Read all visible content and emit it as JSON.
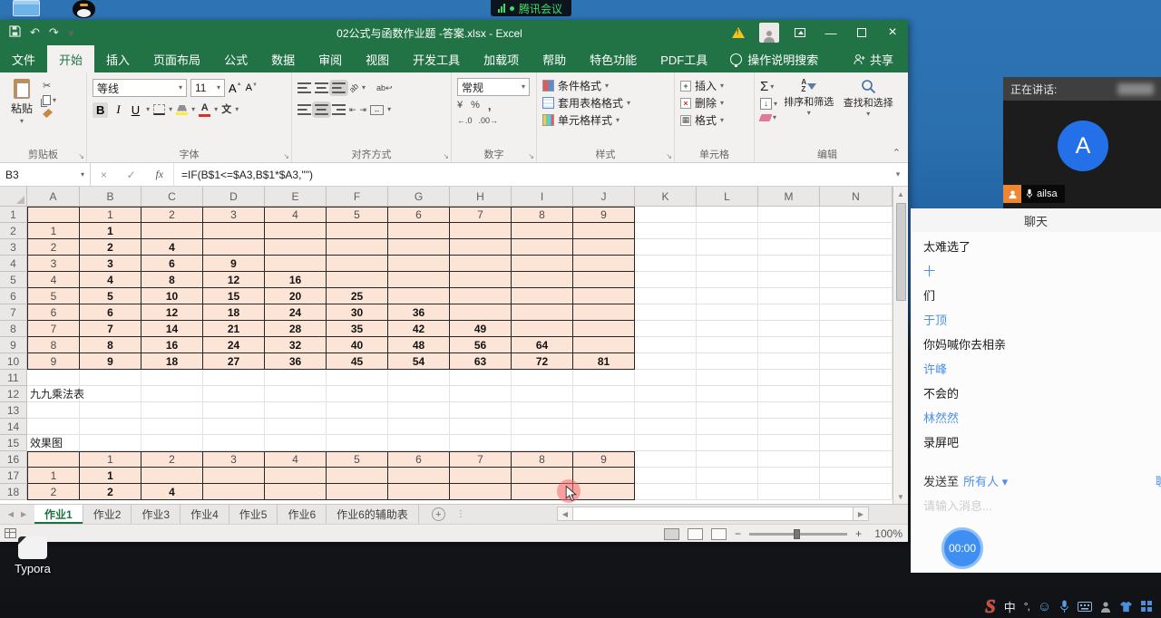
{
  "desktop": {
    "meeting_pill_label": "腾讯会议",
    "typora_label": "Typora"
  },
  "excel": {
    "title": "02公式与函数作业题 -答案.xlsx  -  Excel",
    "ribbon": {
      "tabs": [
        "文件",
        "开始",
        "插入",
        "页面布局",
        "公式",
        "数据",
        "审阅",
        "视图",
        "开发工具",
        "加载项",
        "帮助",
        "特色功能",
        "PDF工具"
      ],
      "active_tab": "开始",
      "search": "操作说明搜索",
      "share": "共享",
      "clipboard": {
        "label": "剪贴板",
        "paste": "粘贴"
      },
      "font": {
        "label": "字体",
        "name": "等线",
        "size": "11",
        "phonetic": "文"
      },
      "align": {
        "label": "对齐方式",
        "wrap": "ab",
        "orient": "ab"
      },
      "number": {
        "label": "数字",
        "format": "常规",
        "currency": "¥",
        "percent": "%",
        "comma": ",",
        "dec_inc": "←.0",
        "dec_dec": ".00→"
      },
      "styles": {
        "label": "样式",
        "cond": "条件格式",
        "table": "套用表格格式",
        "cell": "单元格样式"
      },
      "cells": {
        "label": "单元格",
        "insert": "插入",
        "delete": "删除",
        "format": "格式"
      },
      "edit": {
        "label": "编辑",
        "sort": "排序和筛选",
        "find": "查找和选择"
      }
    },
    "name_box": "B3",
    "formula": "=IF(B$1<=$A3,B$1*$A3,\"\")",
    "sheet_tabs": [
      "作业1",
      "作业2",
      "作业3",
      "作业4",
      "作业5",
      "作业6",
      "作业6的辅助表"
    ],
    "active_sheet": "作业1",
    "zoom_level": "100%"
  },
  "grid": {
    "columns": [
      "A",
      "B",
      "C",
      "D",
      "E",
      "F",
      "G",
      "H",
      "I",
      "J",
      "K",
      "L",
      "M",
      "N"
    ],
    "fill_color": "#fce4d6",
    "rows": [
      {
        "n": "1",
        "kind": "t1h",
        "cells": [
          "",
          "1",
          "2",
          "3",
          "4",
          "5",
          "6",
          "7",
          "8",
          "9"
        ]
      },
      {
        "n": "2",
        "kind": "t1",
        "cells": [
          "1",
          "1",
          "",
          "",
          "",
          "",
          "",
          "",
          "",
          ""
        ]
      },
      {
        "n": "3",
        "kind": "t1",
        "cells": [
          "2",
          "2",
          "4",
          "",
          "",
          "",
          "",
          "",
          "",
          ""
        ]
      },
      {
        "n": "4",
        "kind": "t1",
        "cells": [
          "3",
          "3",
          "6",
          "9",
          "",
          "",
          "",
          "",
          "",
          ""
        ]
      },
      {
        "n": "5",
        "kind": "t1",
        "cells": [
          "4",
          "4",
          "8",
          "12",
          "16",
          "",
          "",
          "",
          "",
          ""
        ]
      },
      {
        "n": "6",
        "kind": "t1",
        "cells": [
          "5",
          "5",
          "10",
          "15",
          "20",
          "25",
          "",
          "",
          "",
          ""
        ]
      },
      {
        "n": "7",
        "kind": "t1",
        "cells": [
          "6",
          "6",
          "12",
          "18",
          "24",
          "30",
          "36",
          "",
          "",
          ""
        ]
      },
      {
        "n": "8",
        "kind": "t1",
        "cells": [
          "7",
          "7",
          "14",
          "21",
          "28",
          "35",
          "42",
          "49",
          "",
          ""
        ]
      },
      {
        "n": "9",
        "kind": "t1",
        "cells": [
          "8",
          "8",
          "16",
          "24",
          "32",
          "40",
          "48",
          "56",
          "64",
          ""
        ]
      },
      {
        "n": "10",
        "kind": "t1",
        "cells": [
          "9",
          "9",
          "18",
          "27",
          "36",
          "45",
          "54",
          "63",
          "72",
          "81"
        ]
      },
      {
        "n": "11",
        "kind": "plain"
      },
      {
        "n": "12",
        "kind": "label",
        "label": "九九乘法表"
      },
      {
        "n": "13",
        "kind": "plain"
      },
      {
        "n": "14",
        "kind": "plain"
      },
      {
        "n": "15",
        "kind": "label",
        "label": "效果图"
      },
      {
        "n": "16",
        "kind": "t2h",
        "cells": [
          "",
          "1",
          "2",
          "3",
          "4",
          "5",
          "6",
          "7",
          "8",
          "9"
        ]
      },
      {
        "n": "17",
        "kind": "t2",
        "cells": [
          "1",
          "1",
          "",
          "",
          "",
          "",
          "",
          "",
          "",
          ""
        ]
      },
      {
        "n": "18",
        "kind": "t2",
        "cells": [
          "2",
          "2",
          "4",
          "",
          "",
          "",
          "",
          "",
          "",
          ""
        ]
      }
    ]
  },
  "meeting": {
    "speaking_label": "正在讲话:",
    "participant_initial": "A",
    "participant_name": "ailsa",
    "chat_title": "聊天",
    "messages": [
      {
        "role": "msg",
        "text": "太难选了"
      },
      {
        "role": "sender",
        "text": "十"
      },
      {
        "role": "msg",
        "text": "们"
      },
      {
        "role": "sender",
        "text": "于顶"
      },
      {
        "role": "msg",
        "text": "你妈喊你去相亲"
      },
      {
        "role": "sender",
        "text": "许峰"
      },
      {
        "role": "msg",
        "text": "不会的"
      },
      {
        "role": "sender",
        "text": "林然然"
      },
      {
        "role": "msg",
        "text": "录屏吧"
      }
    ],
    "send_to_label": "发送至",
    "send_to_value": "所有人",
    "corner_label": "聊",
    "input_placeholder": "请输入消息...",
    "timer": "00:00"
  }
}
